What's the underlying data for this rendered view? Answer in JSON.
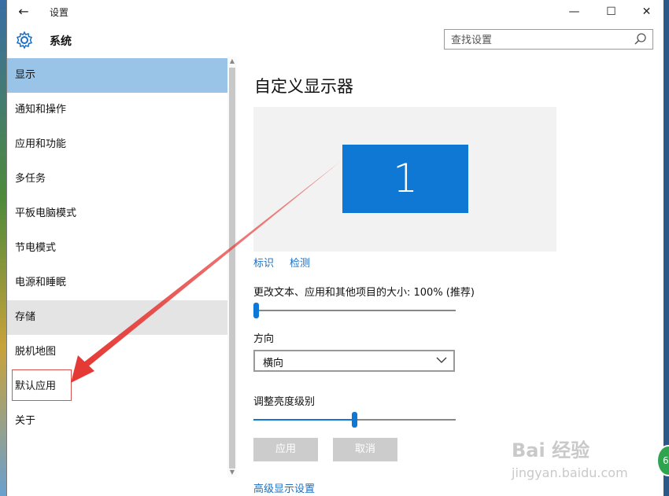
{
  "window": {
    "back_icon": "back-arrow-icon",
    "title": "设置",
    "controls": [
      "minimize-icon",
      "maximize-icon",
      "close-icon"
    ]
  },
  "header": {
    "section_icon": "gear-icon",
    "section_title": "系统",
    "search_placeholder": "查找设置",
    "search_icon": "search-icon"
  },
  "sidebar": {
    "items": [
      {
        "label": "显示",
        "state": "selected"
      },
      {
        "label": "通知和操作",
        "state": "normal"
      },
      {
        "label": "应用和功能",
        "state": "normal"
      },
      {
        "label": "多任务",
        "state": "normal"
      },
      {
        "label": "平板电脑模式",
        "state": "normal"
      },
      {
        "label": "节电模式",
        "state": "normal"
      },
      {
        "label": "电源和睡眠",
        "state": "normal"
      },
      {
        "label": "存储",
        "state": "hover"
      },
      {
        "label": "脱机地图",
        "state": "normal"
      },
      {
        "label": "默认应用",
        "state": "highlighted"
      },
      {
        "label": "关于",
        "state": "normal"
      }
    ]
  },
  "main": {
    "title": "自定义显示器",
    "monitor_number": "1",
    "identify_link": "标识",
    "detect_link": "检测",
    "scale_label": "更改文本、应用和其他项目的大小: 100% (推荐)",
    "scale_slider_value": 0,
    "orientation_label": "方向",
    "orientation_value": "横向",
    "brightness_label": "调整亮度级别",
    "brightness_slider_value": 0.5,
    "apply_button": "应用",
    "cancel_button": "取消",
    "advanced_link": "高级显示设置"
  },
  "colors": {
    "accent": "#0f78d4",
    "selected_bg": "#99c4e8",
    "hover_bg": "#e4e4e4",
    "annotation": "#e53935"
  },
  "watermark": {
    "text": "Bai 经验",
    "sub": "jingyan.baidu.com"
  }
}
